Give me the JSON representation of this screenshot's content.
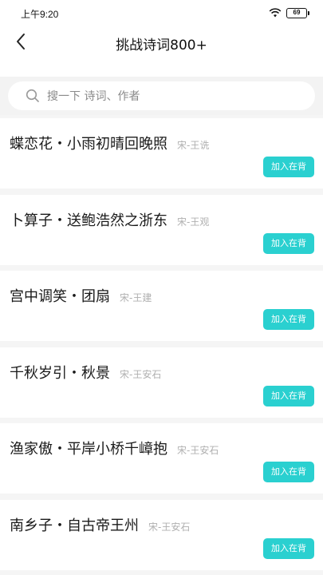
{
  "status_bar": {
    "time": "上午9:20",
    "battery": "69"
  },
  "header": {
    "title": "挑战诗词800+"
  },
  "search": {
    "placeholder": "搜一下 诗词、作者"
  },
  "poems": [
    {
      "title": "蝶恋花・小雨初晴回晚照",
      "author": "宋-王诜",
      "button": "加入在背"
    },
    {
      "title": "卜算子・送鲍浩然之浙东",
      "author": "宋-王观",
      "button": "加入在背"
    },
    {
      "title": "宫中调笑・团扇",
      "author": "宋-王建",
      "button": "加入在背"
    },
    {
      "title": "千秋岁引・秋景",
      "author": "宋-王安石",
      "button": "加入在背"
    },
    {
      "title": "渔家傲・平岸小桥千嶂抱",
      "author": "宋-王安石",
      "button": "加入在背"
    },
    {
      "title": "南乡子・自古帝王州",
      "author": "宋-王安石",
      "button": "加入在背"
    }
  ],
  "colors": {
    "accent": "#2ad0d0",
    "background": "#f5f5f5"
  }
}
